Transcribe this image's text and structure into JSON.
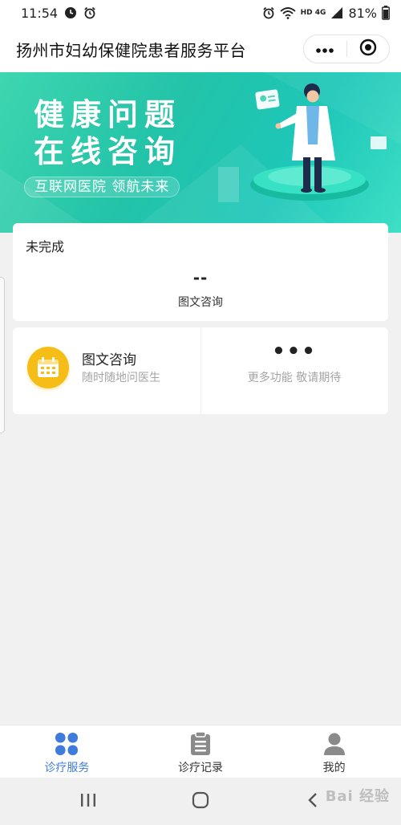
{
  "status_bar": {
    "time": "11:54",
    "battery": "81%",
    "network": "HD 4G"
  },
  "header": {
    "title": "扬州市妇幼保健院患者服务平台"
  },
  "banner": {
    "headline_line1": "健康问题",
    "headline_line2": "在线咨询",
    "tagline": "互联网医院 领航未来"
  },
  "pending": {
    "title": "未完成",
    "value": "--",
    "label": "图文咨询"
  },
  "services": {
    "consult_title": "图文咨询",
    "consult_subtitle": "随时随地问医生",
    "more_icon": "•••",
    "more_text": "更多功能 敬请期待"
  },
  "tabs": [
    {
      "label": "诊疗服务",
      "icon": "grid-icon",
      "active": true
    },
    {
      "label": "诊疗记录",
      "icon": "clipboard-icon",
      "active": false
    },
    {
      "label": "我的",
      "icon": "user-icon",
      "active": false
    }
  ],
  "watermark": "Bai 经验",
  "colors": {
    "accent": "#3f7bdc",
    "banner": "#22c3a8",
    "service_icon": "#f6bd16",
    "muted_text": "#a5a5a5"
  }
}
